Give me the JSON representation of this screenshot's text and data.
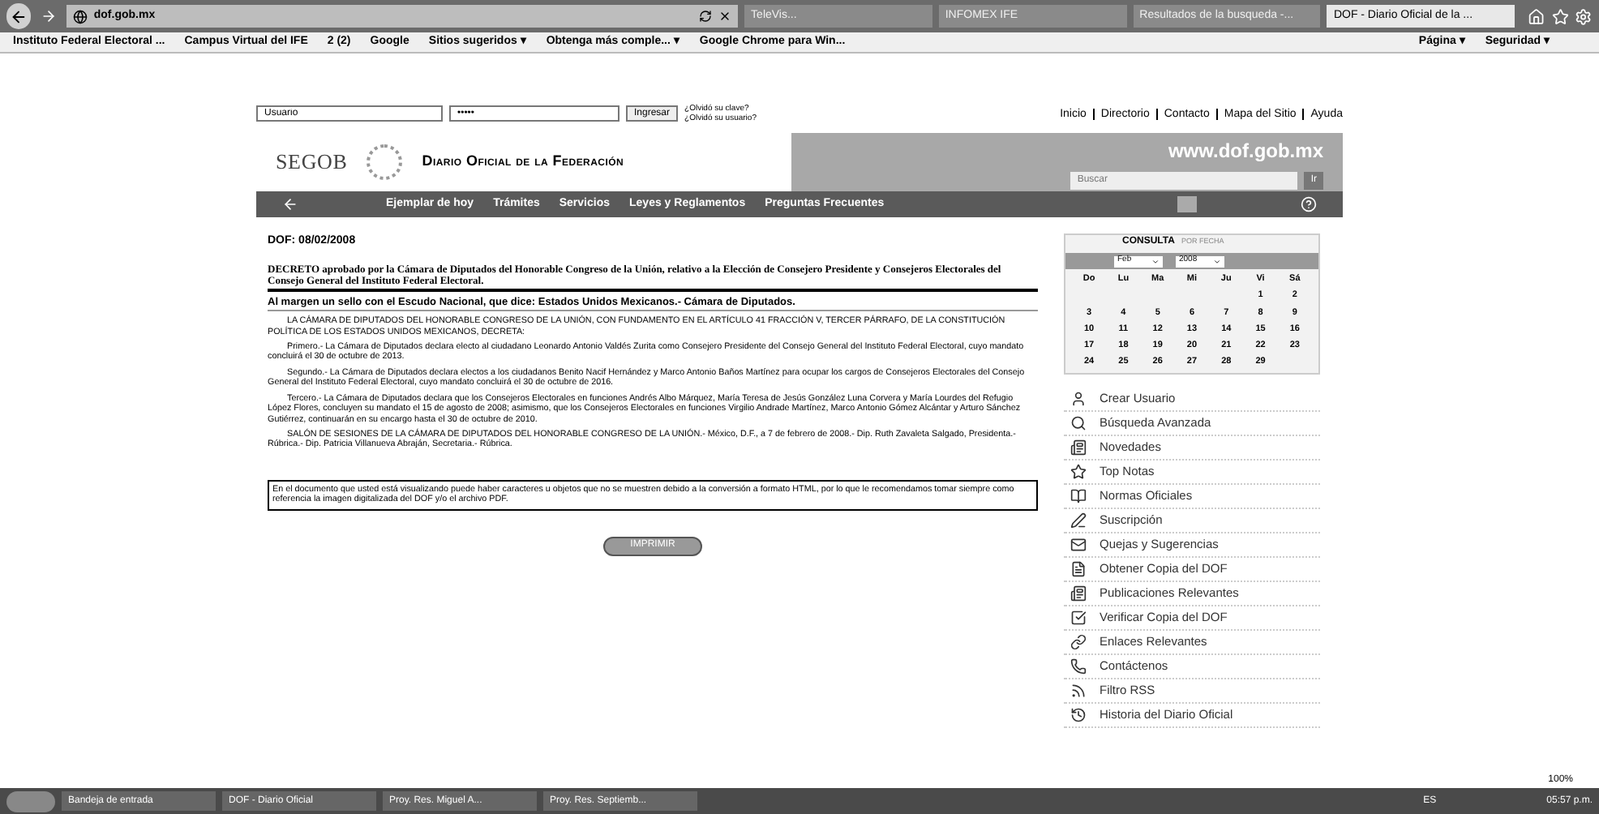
{
  "browser": {
    "address": "dof.gob.mx",
    "tabs": [
      {
        "label": "TeleVis...",
        "selected": false
      },
      {
        "label": "INFOMEX IFE",
        "selected": false
      },
      {
        "label": "Resultados de la busqueda -...",
        "selected": false
      },
      {
        "label": "DOF - Diario Oficial de la ...",
        "selected": true
      }
    ],
    "favorites": [
      "Instituto Federal Electoral ...",
      "Campus Virtual del IFE",
      "2 (2)",
      "Google",
      "Sitios sugeridos ▾",
      "Obtenga más comple... ▾",
      "Google Chrome para Win..."
    ],
    "commands": [
      "Página ▾",
      "Seguridad ▾"
    ]
  },
  "login": {
    "user": "Usuario",
    "password": "•••••",
    "button": "Ingresar",
    "links": [
      "¿Olvidó su clave?",
      "¿Olvidó su usuario?"
    ]
  },
  "top_links": [
    "Inicio",
    "Directorio",
    "Contacto",
    "Mapa del Sitio",
    "Ayuda"
  ],
  "banner": {
    "logo": "SEGOB",
    "title": "Diario Oficial de la Federación",
    "site": "www.dof.gob.mx",
    "search_placeholder": "Buscar",
    "search_button": "Ir"
  },
  "nav": [
    "Ejemplar de hoy",
    "Trámites",
    "Servicios",
    "Leyes y Reglamentos",
    "Preguntas Frecuentes"
  ],
  "article": {
    "date": "DOF: 08/02/2008",
    "title": "**DECRETO** aprobado por la Cámara de Diputados del Honorable Congreso de la Unión, relativo a la Elección de Consejero Presidente y Consejeros Electorales del Consejo General del Instituto Federal Electoral.",
    "seal": "Al margen un sello con el Escudo Nacional, que dice: Estados Unidos Mexicanos.- Cámara de Diputados.",
    "paragraphs": [
      "LA CÁMARA DE DIPUTADOS DEL HONORABLE CONGRESO DE LA UNIÓN, CON FUNDAMENTO EN EL ARTÍCULO 41 FRACCIÓN V, TERCER PÁRRAFO, DE LA CONSTITUCIÓN POLÍTICA DE LOS ESTADOS UNIDOS MEXICANOS, DECRETA:",
      "Primero.- La Cámara de Diputados declara electo al ciudadano Leonardo Antonio Valdés Zurita como Consejero Presidente del Consejo General del Instituto Federal Electoral, cuyo mandato concluirá el 30 de octubre de 2013.",
      "Segundo.- La Cámara de Diputados declara electos a los ciudadanos Benito Nacif Hernández y Marco Antonio Baños Martínez para ocupar los cargos de Consejeros Electorales del Consejo General del Instituto Federal Electoral, cuyo mandato concluirá el 30 de octubre de 2016.",
      "Tercero.- La Cámara de Diputados declara que los Consejeros Electorales en funciones Andrés Albo Márquez, María Teresa de Jesús González Luna Corvera y María Lourdes del Refugio López Flores, concluyen su mandato el 15 de agosto de 2008; asimismo, que los Consejeros Electorales en funciones Virgilio Andrade Martínez, Marco Antonio Gómez Alcántar y Arturo Sánchez Gutiérrez, continuarán en su encargo hasta el 30 de octubre de 2010.",
      "SALÓN DE SESIONES DE LA CÁMARA DE DIPUTADOS DEL HONORABLE CONGRESO DE LA UNIÓN.- México, D.F., a 7 de febrero de 2008.- Dip. Ruth Zavaleta Salgado, Presidenta.- Rúbrica.- Dip. Patricia Villanueva Abraján, Secretaria.- Rúbrica."
    ],
    "notice": "En el documento que usted está visualizando puede haber caracteres u objetos que no se muestren debido a la conversión a formato HTML, por lo que le recomendamos tomar siempre como referencia la imagen digitalizada del DOF y/o el archivo PDF.",
    "print_button": "IMPRIMIR"
  },
  "calendar": {
    "title": "CONSULTA",
    "subtitle": "POR FECHA",
    "month": "Feb",
    "year": "2008",
    "weekdays": [
      "Do",
      "Lu",
      "Ma",
      "Mi",
      "Ju",
      "Vi",
      "Sá"
    ],
    "days": [
      "1",
      "2",
      "3",
      "4",
      "5",
      "6",
      "7",
      "8",
      "9",
      "10",
      "11",
      "12",
      "13",
      "14",
      "15",
      "16",
      "17",
      "18",
      "19",
      "20",
      "21",
      "22",
      "23",
      "24",
      "25",
      "26",
      "27",
      "28",
      "29"
    ]
  },
  "menu": [
    "Crear Usuario",
    "Búsqueda Avanzada",
    "Novedades",
    "Top Notas",
    "Normas Oficiales",
    "Suscripción",
    "Quejas y Sugerencias",
    "Obtener Copia del DOF",
    "Publicaciones Relevantes",
    "Verificar Copia del DOF",
    "Enlaces Relevantes",
    "Contáctenos",
    "Filtro RSS",
    "Historia del Diario Oficial"
  ],
  "zoom": "100%",
  "taskbar": {
    "items": [
      "Bandeja de entrada",
      "DOF - Diario Oficial",
      "Proy. Res. Miguel A...",
      "Proy. Res. Septiemb..."
    ],
    "language": "ES",
    "clock": "05:57 p.m."
  }
}
